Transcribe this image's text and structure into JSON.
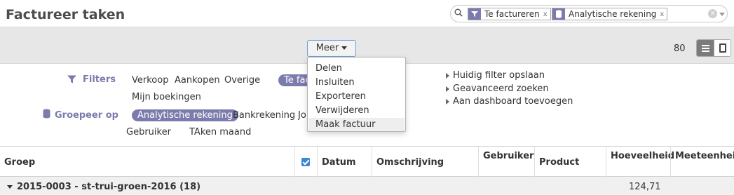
{
  "header": {
    "title": "Factureer taken",
    "search": {
      "facets": [
        {
          "label": "Te factureren",
          "icon": "filter-icon"
        },
        {
          "label": "Analytische rekening",
          "icon": "group-icon"
        }
      ],
      "remove_glyph": "x",
      "clear_glyph": "x"
    }
  },
  "toolbar": {
    "more_label": "Meer",
    "pager": "80"
  },
  "more_menu": {
    "items": [
      "Delen",
      "Insluiten",
      "Exporteren",
      "Verwijderen",
      "Maak factuur"
    ],
    "highlighted": "Maak factuur"
  },
  "filters_panel": {
    "filters_label": "Filters",
    "filters": [
      "Verkoop",
      "Aankopen",
      "Overige",
      "Te factureren",
      "Mijn boekingen"
    ],
    "groupby_label": "Groepeer op",
    "groupby": [
      "Analytische rekening",
      "Bankrekening",
      "Journaal",
      "Gebruiker",
      "TAken maand"
    ],
    "favorites": [
      "Huidig filter opslaan",
      "Geavanceerd zoeken",
      "Aan dashboard toevoegen"
    ]
  },
  "table": {
    "columns": [
      "Groep",
      "Datum",
      "Omschrijving",
      "Gebruiker",
      "Product",
      "Hoeveelheid",
      "Meeteenheid"
    ],
    "group_row": {
      "label": "2015-0003 - st-trui-groen-2016 (18)",
      "quantity": "124,71"
    }
  },
  "colors": {
    "accent": "#7c7bad",
    "checkbox": "#3d87d9",
    "toolbar_bg": "#e7e7e7"
  }
}
